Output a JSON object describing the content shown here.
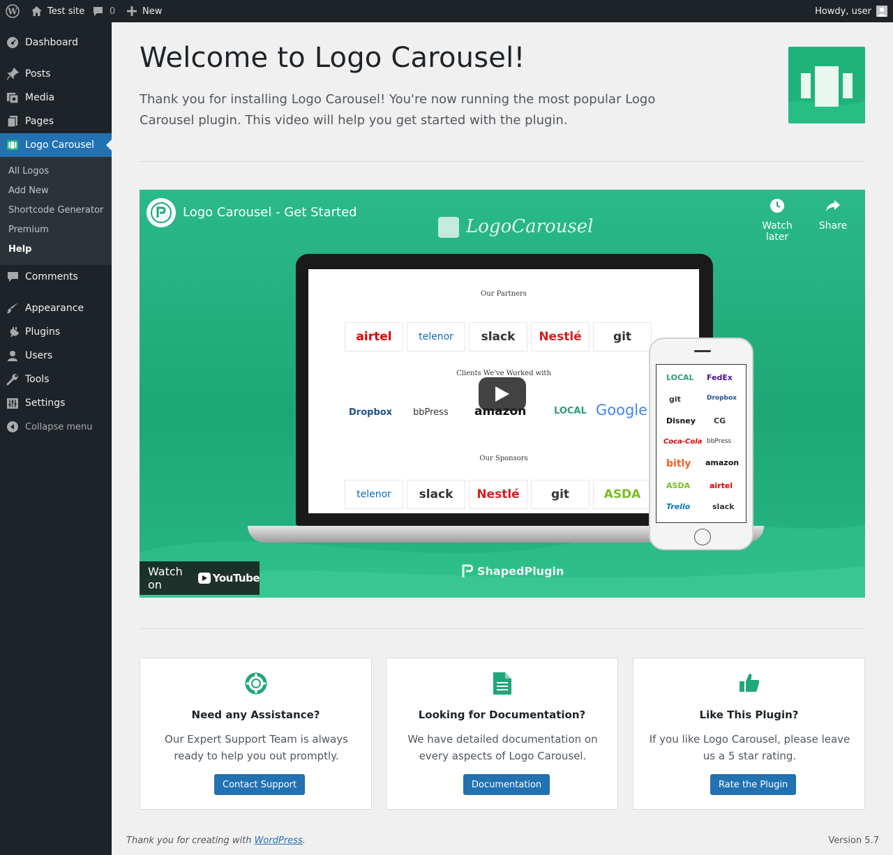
{
  "adminbar": {
    "site_name": "Test site",
    "comments_count": "0",
    "new_label": "New",
    "greeting": "Howdy, user"
  },
  "sidebar": {
    "items": [
      {
        "label": "Dashboard",
        "icon": "dashboard-icon"
      },
      {
        "label": "Posts",
        "icon": "pin-icon"
      },
      {
        "label": "Media",
        "icon": "media-icon"
      },
      {
        "label": "Pages",
        "icon": "pages-icon"
      },
      {
        "label": "Logo Carousel",
        "icon": "logo-carousel-icon"
      },
      {
        "label": "Comments",
        "icon": "comment-icon"
      },
      {
        "label": "Appearance",
        "icon": "brush-icon"
      },
      {
        "label": "Plugins",
        "icon": "plugin-icon"
      },
      {
        "label": "Users",
        "icon": "user-icon"
      },
      {
        "label": "Tools",
        "icon": "wrench-icon"
      },
      {
        "label": "Settings",
        "icon": "settings-icon"
      }
    ],
    "submenu": [
      "All Logos",
      "Add New",
      "Shortcode Generator",
      "Premium",
      "Help"
    ],
    "collapse_label": "Collapse menu"
  },
  "main": {
    "title": "Welcome to Logo Carousel!",
    "intro": "Thank you for installing Logo Carousel! You're now running the most popular Logo Carousel plugin. This video will help you get started with the plugin."
  },
  "video": {
    "title": "Logo Carousel - Get Started",
    "watch_later": "Watch later",
    "share": "Share",
    "brand": "LogoCarousel",
    "watch_on": "Watch on",
    "youtube": "YouTube",
    "footer_brand": "ShapedPlugin",
    "sections": [
      "Our Partners",
      "Clients We've Worked with",
      "Our Sponsors"
    ],
    "partners": [
      "airtel",
      "telenor",
      "slack",
      "Nestlé",
      "git"
    ],
    "clients": [
      "Dropbox",
      "bbPress",
      "amazon",
      "LOCAL",
      "Google"
    ],
    "sponsors": [
      "telenor",
      "slack",
      "Nestlé",
      "git",
      "ASDA"
    ],
    "phone_logos": [
      "LOCAL",
      "FedEx",
      "git",
      "Dropbox",
      "Disney",
      "CG",
      "Coca-Cola",
      "bbPress",
      "bitly",
      "amazon",
      "ASDA",
      "airtel",
      "Trello",
      "slack"
    ]
  },
  "cards": [
    {
      "title": "Need any Assistance?",
      "text": "Our Expert Support Team is always ready to help you out promptly.",
      "button": "Contact Support",
      "icon": "lifebuoy-icon"
    },
    {
      "title": "Looking for Documentation?",
      "text": "We have detailed documentation on every aspects of Logo Carousel.",
      "button": "Documentation",
      "icon": "document-icon"
    },
    {
      "title": "Like This Plugin?",
      "text": "If you like Logo Carousel, please leave us a 5 star rating.",
      "button": "Rate the Plugin",
      "icon": "thumbs-up-icon"
    }
  ],
  "footer": {
    "thanks_prefix": "Thank you for creating with ",
    "wordpress": "WordPress",
    "thanks_suffix": ".",
    "version": "Version 5.7"
  },
  "colors": {
    "accent": "#2271b1",
    "brand_green": "#1fb37a",
    "sidebar_bg": "#1d2327"
  }
}
